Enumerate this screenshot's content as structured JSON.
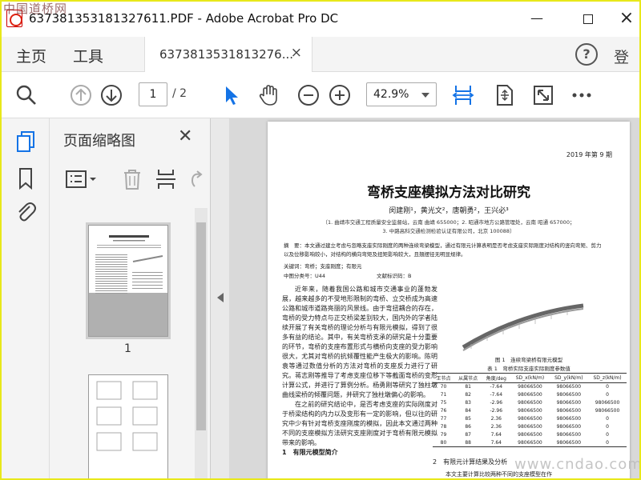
{
  "window": {
    "title": "637381353181327611.PDF - Adobe Acrobat Pro DC",
    "watermark_top": "中国道桥网",
    "watermark_bottom": "www.cndao.com"
  },
  "menubar": {
    "home": "主页",
    "tools": "工具",
    "doc_tab": "6373813531813276...",
    "login": "登录"
  },
  "toolbar": {
    "page_current": "1",
    "page_total": "/ 2",
    "zoom": "42.9%"
  },
  "thumbnails": {
    "title": "页面缩略图",
    "page_label": "1"
  },
  "document": {
    "issue": "2019 年第 9 期",
    "title": "弯桥支座模拟方法对比研究",
    "authors": "闵建刚¹，黄光文²，唐朝勇²，王兴必³",
    "affil1": "（1. 曲靖市交通工程质量安全监督站，云南  曲靖  655000；2. 昭通市地方公路管理处，云南  昭通  657000；",
    "affil2": "3. 中路高科交通检测检验认证有限公司，北京  100088）",
    "abstract": "摘　要：本文通过建立考虑与忽略支座实际刚度的两种连续弯梁模型，通过有限元计算表明是否考虑支座实际刚度对结构的竖向弯矩、剪力以及位移影响较小，对结构的横向弯矩及扭矩影响较大，且翘摆径无明显规律。",
    "keywords": "关键词：弯桥；支座刚度；有限元",
    "class_no": "中图分类号：U44",
    "doc_id": "文献标识码：B",
    "body_p1": "近年来，随着我国公路和城市交通事业的蓬勃发展，越来越多的不受地形限制的弯桥、立交桥成为高速公路和城市道路亮丽的风景线。由于弯扭耦合的存在，弯桥的受力特点与正交桥梁差别较大，国内外的学者陆续开展了有关弯桥的理论分析与有限元模拟，得到了很多有益的结论。其中，有关弯桥支承的研究是十分重要的环节，弯桥的支座布置形式与横桥向支座的受力影响很大，尤其对弯桥的抗倾覆性能产生极大的影响。陈明袁等通过数值分析的方法对弯桥的支座反力进行了研究。蒋志刚等推导了考虑支座位移下等截面弯桥的变形计算公式，并进行了算例分析。杨勇刚等研究了独柱墩曲线梁桥的倾覆问题，并研究了独柱墩偏心的影响。",
    "body_p2": "在之前的研究结论中，是否考虑支座的实际刚度对于桥梁结构的内力以及变形有一定的影响，但以往的研究中少有针对弯桥支座刚度的模拟，因此本文通过两种不同的支座模拟方法研究支座刚度对于弯桥有限元模拟带来的影响。",
    "body_sec1": "1　有限元模型简介",
    "fig_caption": "图 1　连续弯梁桥有限元模型",
    "table_caption": "表 1　弯桥实际支座实际刚度参数值",
    "table_headers": [
      "王节点",
      "从属节点",
      "角度/deg",
      "SD_x(kN/m)",
      "SD_y(kN/m)",
      "SD_z(kN/m)"
    ],
    "table_rows": [
      [
        "70",
        "81",
        "-7.64",
        "98066500",
        "98066500",
        "0"
      ],
      [
        "71",
        "82",
        "-7.64",
        "98066500",
        "98066500",
        "0"
      ],
      [
        "75",
        "83",
        "-2.96",
        "98066500",
        "98066500",
        "98066500"
      ],
      [
        "76",
        "84",
        "-2.96",
        "98066500",
        "98066500",
        "98066500"
      ],
      [
        "77",
        "85",
        "2.36",
        "98066500",
        "98066500",
        "0"
      ],
      [
        "78",
        "86",
        "2.36",
        "98066500",
        "98066500",
        "0"
      ],
      [
        "79",
        "87",
        "7.64",
        "98066500",
        "98066500",
        "0"
      ],
      [
        "80",
        "88",
        "7.64",
        "98066500",
        "98066500",
        "0"
      ]
    ],
    "sec2_title": "2　有限元计算结果及分析",
    "sec2_text": "本文主要计算比较两种不同的支座模型在作"
  }
}
